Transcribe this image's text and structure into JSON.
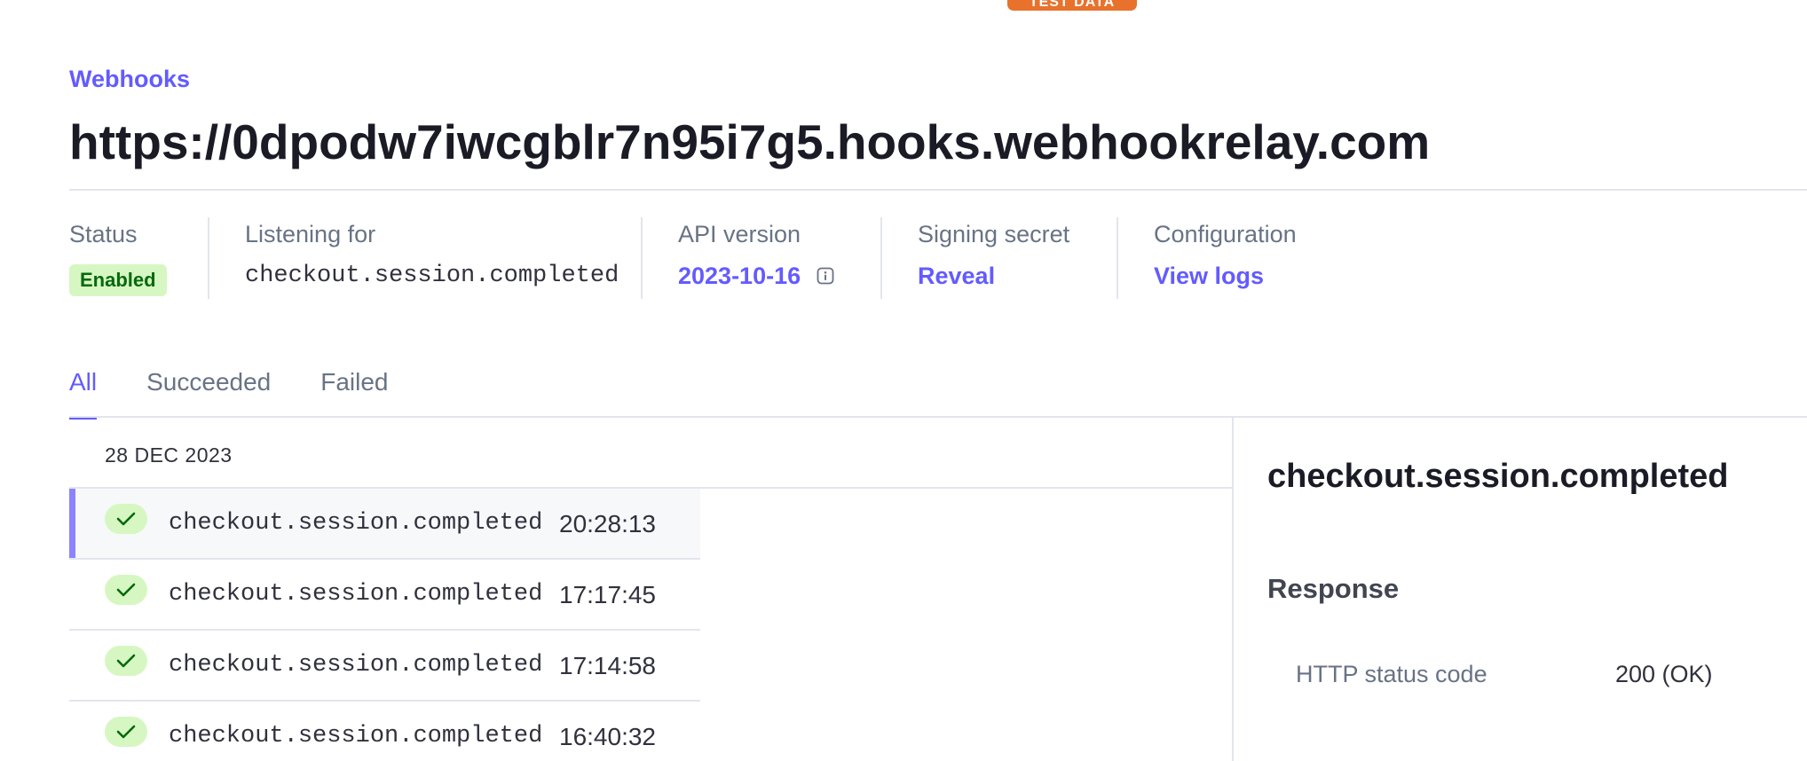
{
  "header": {
    "test_badge": "TEST DATA",
    "breadcrumb": "Webhooks",
    "title": "https://0dpodw7iwcgblr7n95i7g5.hooks.webhookrelay.com"
  },
  "meta": {
    "status": {
      "label": "Status",
      "value": "Enabled"
    },
    "listening_for": {
      "label": "Listening for",
      "value": "checkout.session.completed"
    },
    "api_version": {
      "label": "API version",
      "value": "2023-10-16",
      "icon": "info-icon"
    },
    "signing_secret": {
      "label": "Signing secret",
      "value": "Reveal"
    },
    "configuration": {
      "label": "Configuration",
      "value": "View logs"
    }
  },
  "tabs": [
    {
      "label": "All",
      "active": true
    },
    {
      "label": "Succeeded",
      "active": false
    },
    {
      "label": "Failed",
      "active": false
    }
  ],
  "events": {
    "date_header": "28 DEC 2023",
    "items": [
      {
        "name": "checkout.session.completed",
        "time": "20:28:13",
        "status": "succeeded",
        "selected": true
      },
      {
        "name": "checkout.session.completed",
        "time": "17:17:45",
        "status": "succeeded",
        "selected": false
      },
      {
        "name": "checkout.session.completed",
        "time": "17:14:58",
        "status": "succeeded",
        "selected": false
      },
      {
        "name": "checkout.session.completed",
        "time": "16:40:32",
        "status": "succeeded",
        "selected": false
      }
    ]
  },
  "detail": {
    "title": "checkout.session.completed",
    "response_heading": "Response",
    "http_status_label": "HTTP status code",
    "http_status_value": "200 (OK)"
  },
  "colors": {
    "accent": "#635bff",
    "success_bg": "#d7f7c2",
    "success_fg": "#05690d",
    "test_badge": "#e8722c"
  }
}
